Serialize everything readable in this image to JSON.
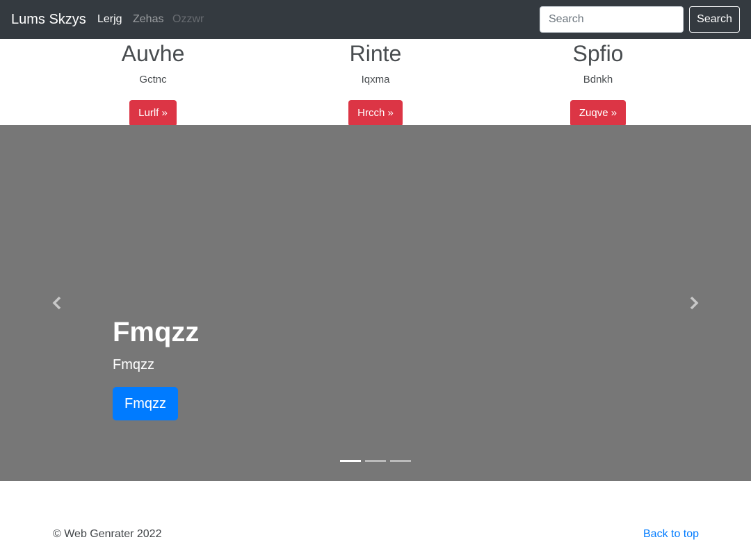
{
  "navbar": {
    "brand": "Lums Skzys",
    "links": [
      "Lerjg",
      "Zehas",
      "Ozzwr"
    ],
    "search_placeholder": "Search",
    "search_button": "Search"
  },
  "features": [
    {
      "heading": "Auvhe",
      "text": "Gctnc",
      "button": "Lurlf »"
    },
    {
      "heading": "Rinte",
      "text": "Iqxma",
      "button": "Hrcch »"
    },
    {
      "heading": "Spfio",
      "text": "Bdnkh",
      "button": "Zuqve »"
    }
  ],
  "carousel": {
    "title": "Fmqzz",
    "subtitle": "Fmqzz",
    "button": "Fmqzz",
    "slides_total": 3,
    "active_slide": 1
  },
  "footer": {
    "copyright": "© Web Genrater 2022",
    "back_to_top": "Back to top"
  },
  "colors": {
    "navbar_bg": "#343a40",
    "feature_button": "#dc3545",
    "carousel_bg": "#777777",
    "primary": "#007bff"
  }
}
